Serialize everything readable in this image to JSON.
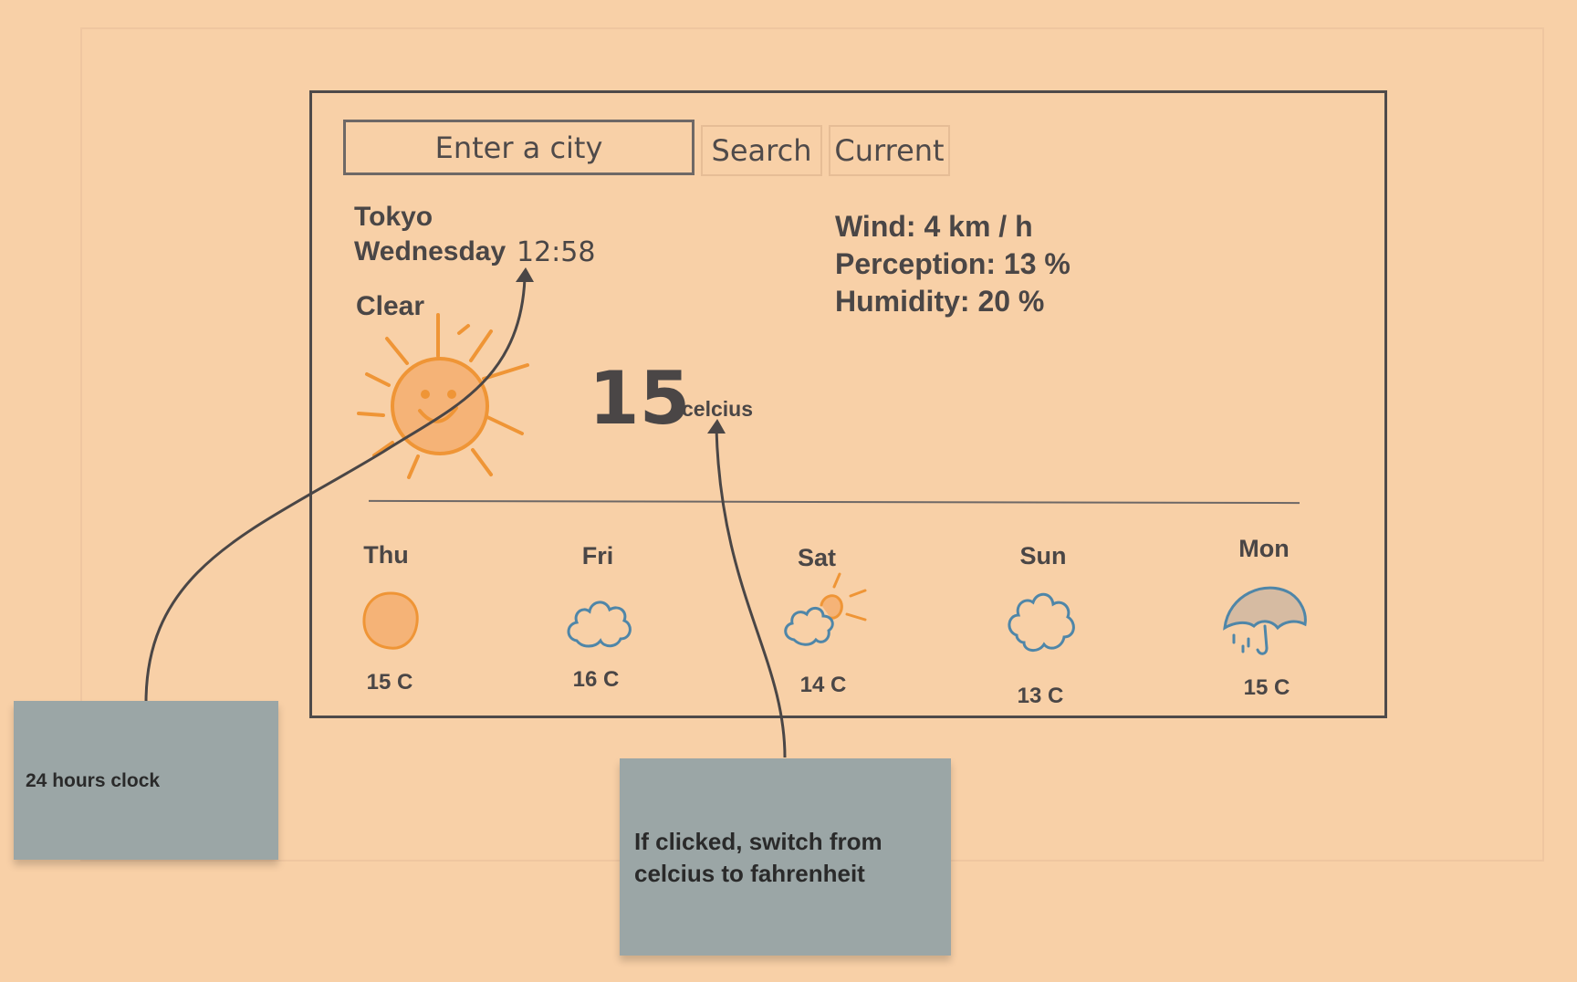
{
  "search": {
    "placeholder": "Enter a city",
    "search_label": "Search",
    "current_label": "Current"
  },
  "current": {
    "city": "Tokyo",
    "day": "Wednesday",
    "time": "12:58",
    "condition": "Clear",
    "condition_icon": "smiling-sun-icon",
    "temperature": "15",
    "unit": "celcius"
  },
  "stats": {
    "wind": "Wind: 4 km / h",
    "perception": "Perception: 13 %",
    "humidity": "Humidity: 20 %"
  },
  "forecast": [
    {
      "day": "Thu",
      "temp": "15 C",
      "icon": "sun-icon"
    },
    {
      "day": "Fri",
      "temp": "16 C",
      "icon": "cloud-icon"
    },
    {
      "day": "Sat",
      "temp": "14 C",
      "icon": "partly-cloudy-icon"
    },
    {
      "day": "Sun",
      "temp": "13 C",
      "icon": "cloud-icon"
    },
    {
      "day": "Mon",
      "temp": "15 C",
      "icon": "rain-umbrella-icon"
    }
  ],
  "annotations": {
    "clock_note": "24 hours clock",
    "unit_note_line1": "If clicked, switch from",
    "unit_note_line2": "celcius to fahrenheit"
  },
  "colors": {
    "background": "#f8d0a7",
    "sun": "#ef9536",
    "cloud": "#4f86a8",
    "note": "#9ba6a6"
  }
}
